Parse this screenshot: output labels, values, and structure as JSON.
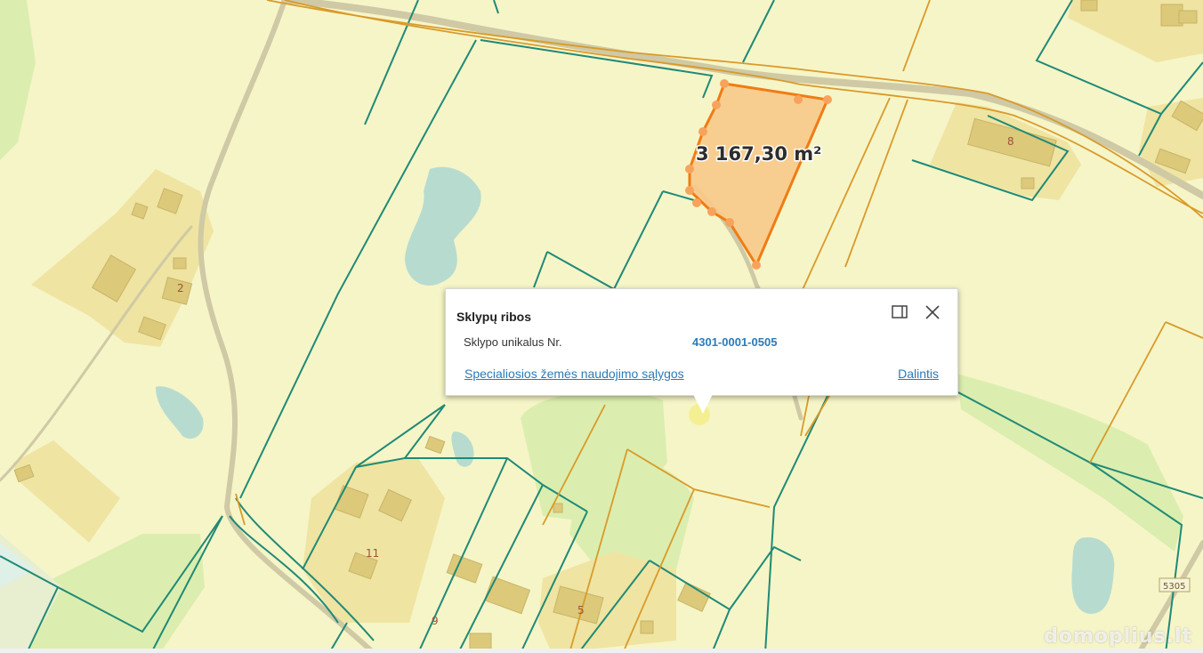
{
  "map": {
    "selected_area_label": "3 167,30 m²",
    "house_numbers": [
      "2",
      "8",
      "11",
      "9",
      "5"
    ],
    "road_label": "5305",
    "watermark": "domoplius.lt",
    "colors": {
      "base": "#f6f5c8",
      "parcel_teal": "#1f8a76",
      "parcel_orange": "#d99a2a",
      "selection_fill": "#f8c98a",
      "selection_stroke": "#f07c12",
      "water": "#b7dccf",
      "green": "#dbeeaf",
      "building": "#e9dc8e",
      "road": "#cfc9a5"
    }
  },
  "popup": {
    "title": "Sklypų ribos",
    "field_label": "Sklypo unikalus Nr.",
    "field_value": "4301-0001-0505",
    "link_conditions": "Specialiosios žemės naudojimo sąlygos",
    "link_share": "Dalintis",
    "dock_icon": "dock-panel-icon",
    "close_icon": "close-icon"
  }
}
